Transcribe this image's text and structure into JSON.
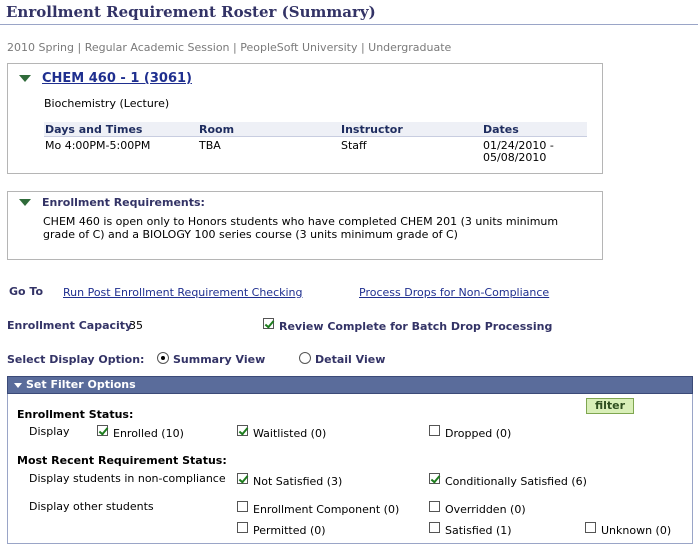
{
  "page": {
    "title": "Enrollment Requirement Roster (Summary)",
    "context": "2010 Spring | Regular Academic Session | PeopleSoft University | Undergraduate"
  },
  "course": {
    "link": "CHEM 460 - 1 (3061)",
    "description": "Biochemistry (Lecture)",
    "headers": {
      "days": "Days and Times",
      "room": "Room",
      "instructor": "Instructor",
      "dates": "Dates"
    },
    "row": {
      "days": "Mo 4:00PM-5:00PM",
      "room": "TBA",
      "instructor": "Staff",
      "dates_line1": "01/24/2010 -",
      "dates_line2": "05/08/2010"
    }
  },
  "requirements": {
    "heading": "Enrollment Requirements:",
    "line1": "CHEM 460 is open only to Honors students who have completed CHEM 201 (3 units minimum",
    "line2": "grade of C) and a  BIOLOGY 100 series course (3 units minimum grade of C)"
  },
  "goto": {
    "label": "Go To",
    "run_post": "Run Post Enrollment Requirement Checking",
    "process_drops": "Process Drops for Non-Compliance"
  },
  "capacity": {
    "label": "Enrollment Capacity",
    "value": "35"
  },
  "review": {
    "label": "Review Complete for Batch Drop Processing",
    "checked": true
  },
  "display_option": {
    "label": "Select Display Option:",
    "summary": "Summary View",
    "detail": "Detail View",
    "selected": "summary"
  },
  "filter": {
    "header": "Set Filter Options",
    "button": "filter",
    "enrollment_status_label": "Enrollment Status:",
    "display_label": "Display",
    "enrolled": "Enrolled (10)",
    "waitlisted": "Waitlisted (0)",
    "dropped": "Dropped (0)",
    "recent_label": "Most Recent Requirement Status:",
    "noncompliance_label": "Display students in non-compliance",
    "not_satisfied": "Not Satisfied (3)",
    "cond_satisfied": "Conditionally Satisfied (6)",
    "other_label": "Display other students",
    "enroll_component": "Enrollment Component (0)",
    "overridden": "Overridden (0)",
    "permitted": "Permitted (0)",
    "satisfied": "Satisfied (1)",
    "unknown": "Unknown (0)"
  },
  "colors": {
    "accent": "#333366",
    "link": "#1f2f8f",
    "bar": "#5a6c9b",
    "check": "#1e7d1e"
  }
}
